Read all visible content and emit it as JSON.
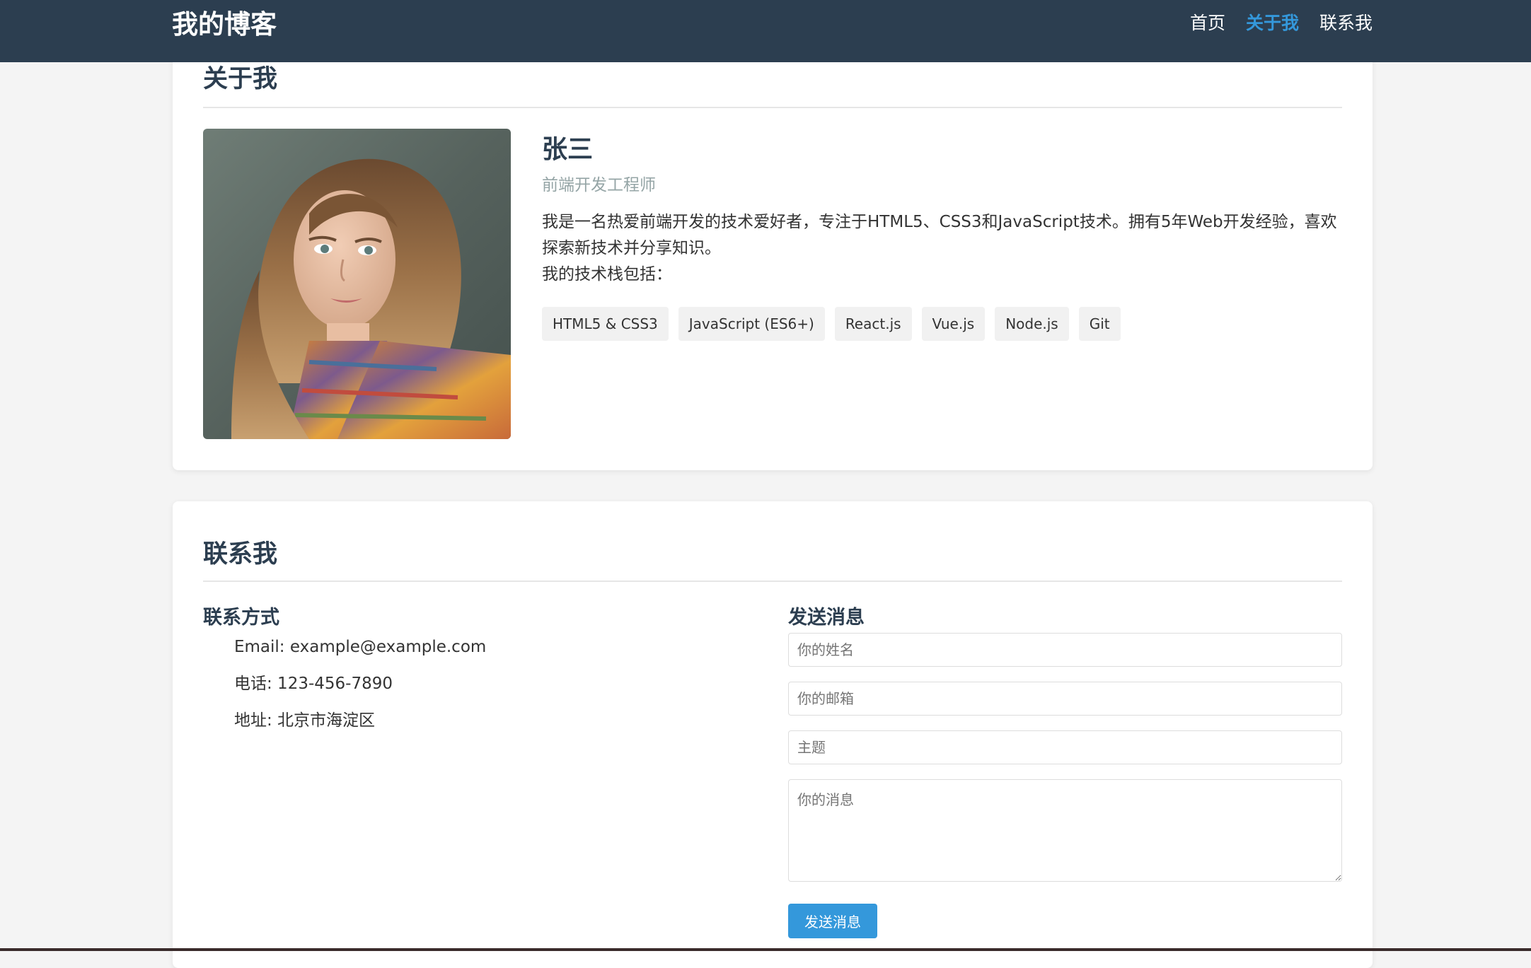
{
  "header": {
    "logo": "我的博客",
    "nav": [
      {
        "label": "首页",
        "active": false
      },
      {
        "label": "关于我",
        "active": true
      },
      {
        "label": "联系我",
        "active": false
      }
    ],
    "bg_color": "#2c3e50",
    "active_color": "#3498db"
  },
  "about": {
    "title": "关于我",
    "avatar_icon": "portrait-photo",
    "name": "张三",
    "role": "前端开发工程师",
    "bio": "我是一名热爱前端开发的技术爱好者，专注于HTML5、CSS3和JavaScript技术。拥有5年Web开发经验，喜欢探索新技术并分享知识。",
    "stack_intro": "我的技术栈包括：",
    "tags": [
      "HTML5 & CSS3",
      "JavaScript (ES6+)",
      "React.js",
      "Vue.js",
      "Node.js",
      "Git"
    ]
  },
  "contact": {
    "title": "联系我",
    "info_title": "联系方式",
    "info": [
      "Email: example@example.com",
      "电话: 123-456-7890",
      "地址: 北京市海淀区"
    ],
    "form_title": "发送消息",
    "form": {
      "name_placeholder": "你的姓名",
      "email_placeholder": "你的邮箱",
      "subject_placeholder": "主题",
      "message_placeholder": "你的消息",
      "submit_label": "发送消息"
    },
    "accent_color": "#3498db"
  }
}
